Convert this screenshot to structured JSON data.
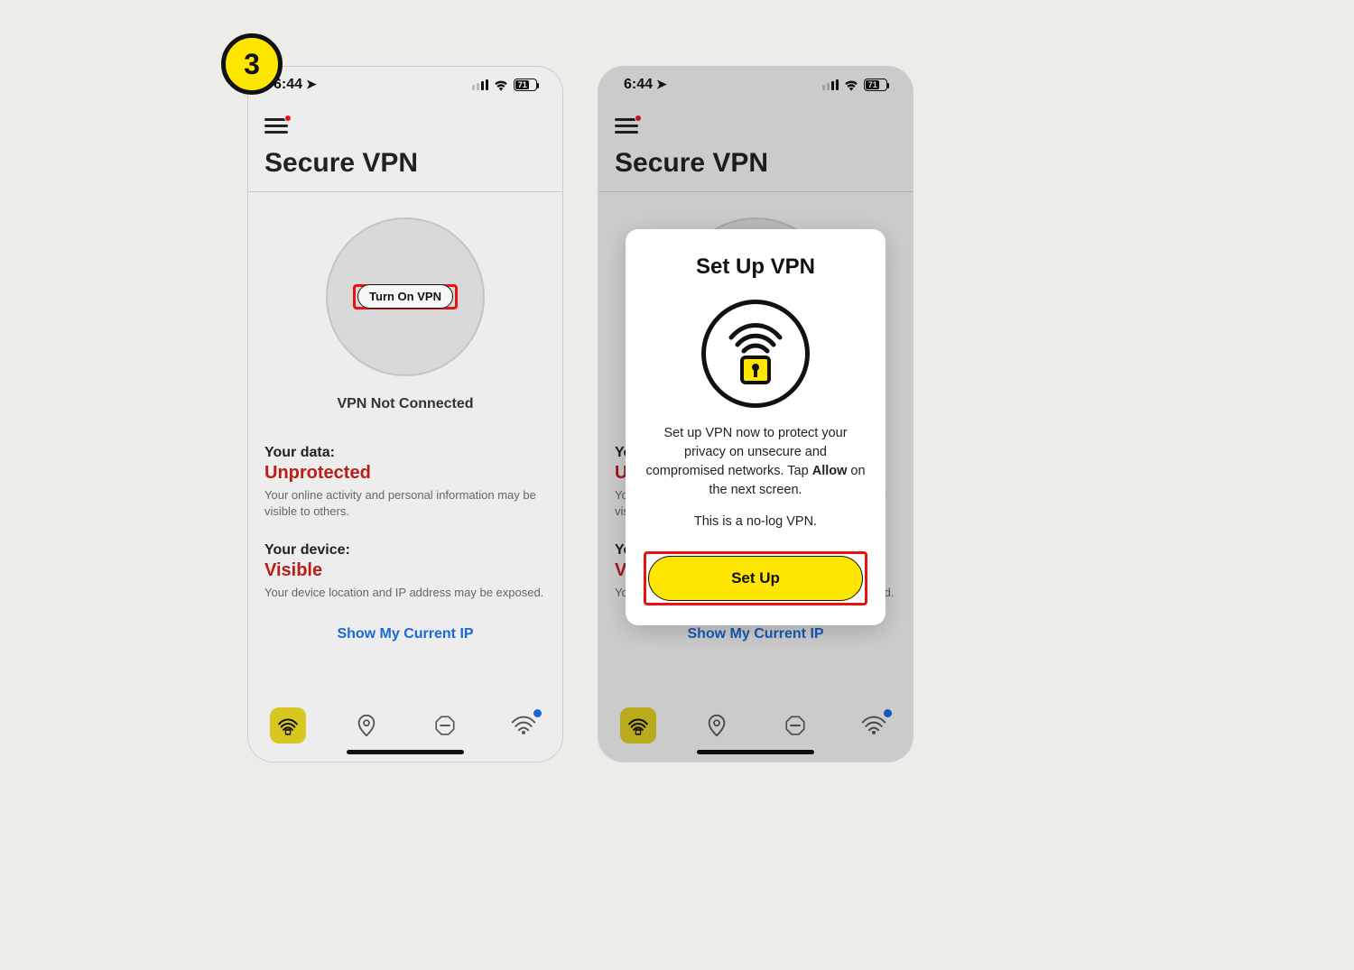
{
  "step_number": "3",
  "statusbar": {
    "time": "6:44",
    "battery": "71"
  },
  "page_title": "Secure VPN",
  "turn_on_label": "Turn On VPN",
  "vpn_status": "VPN Not Connected",
  "data_block": {
    "label": "Your data:",
    "value": "Unprotected",
    "desc": "Your online activity and personal information may be visible to others."
  },
  "device_block": {
    "label": "Your device:",
    "value": "Visible",
    "desc": "Your device location and IP address may be exposed."
  },
  "show_ip": "Show My Current IP",
  "modal": {
    "title": "Set Up VPN",
    "body_pre": "Set up VPN now to protect your privacy on unsecure and compromised networks. Tap ",
    "body_allow": "Allow",
    "body_post": " on the next screen.",
    "noline": "This is a no-log VPN.",
    "button": "Set Up"
  }
}
